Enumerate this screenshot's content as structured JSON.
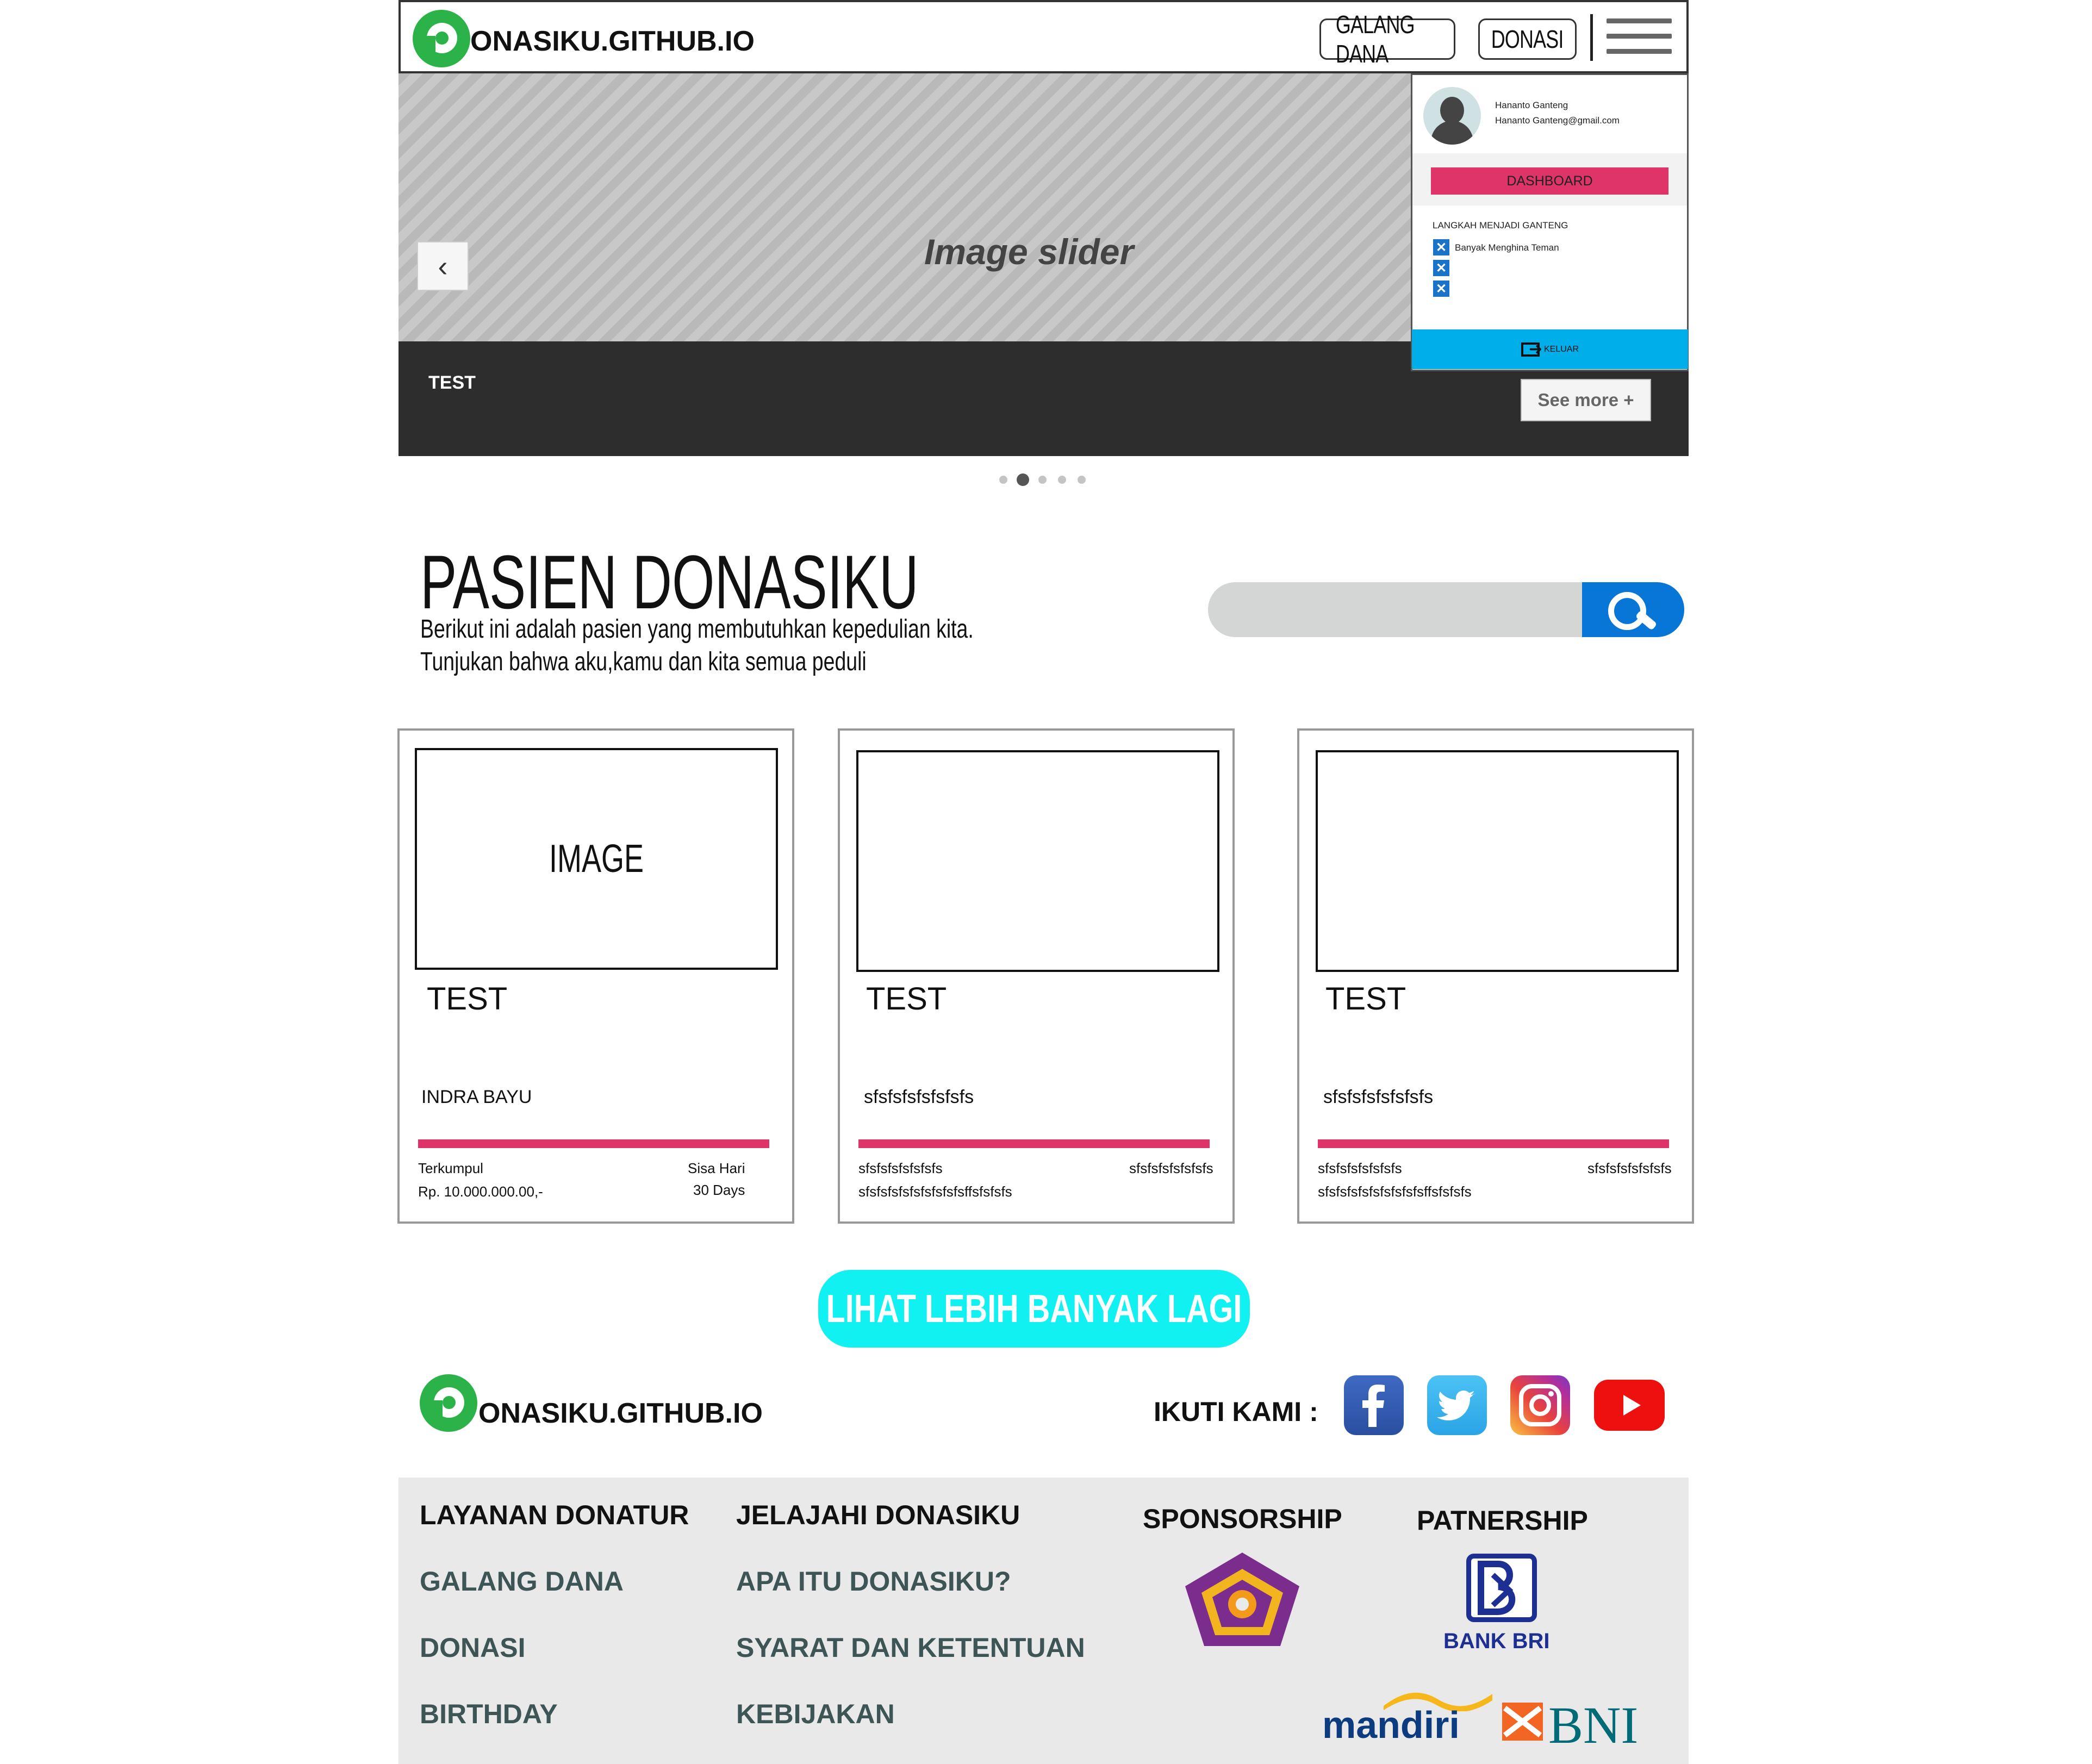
{
  "nav": {
    "brand_tail": "ONASIKU.GITHUB.IO",
    "galang_label": "GALANG DANA",
    "donasi_label": "DONASI"
  },
  "hero": {
    "title": "Image slider",
    "caption": "TEST",
    "see_more_label": "See more +",
    "prev_glyph": "‹",
    "active_slide": 2,
    "slide_count": 5
  },
  "user_panel": {
    "name": "Hananto Ganteng",
    "email": "Hananto Ganteng@gmail.com",
    "dashboard_label": "DASHBOARD",
    "steps_title": "LANGKAH MENJADI GANTENG",
    "steps": [
      "Banyak Menghina Teman",
      "",
      ""
    ],
    "logout_label": "KELUAR"
  },
  "patients": {
    "title": "PASIEN DONASIKU",
    "desc_line1": "Berikut ini adalah pasien yang membutuhkan kepedulian kita.",
    "desc_line2": "Tunjukan bahwa aku,kamu dan kita semua peduli",
    "search_placeholder": ""
  },
  "cards": [
    {
      "image_label": "IMAGE",
      "title": "TEST",
      "name": "INDRA BAYU",
      "left_top": "Terkumpul",
      "left_bottom": "Rp. 10.000.000.00,-",
      "right_top": "Sisa Hari",
      "right_bottom": "30 Days"
    },
    {
      "image_label": "",
      "title": "TEST",
      "name": "sfsfsfsfsfsfsfs",
      "left_top": "sfsfsfsfsfsfsfs",
      "left_bottom": "sfsfsfsfsfsfsfsfsfsffsfsfsfs",
      "right_top": "sfsfsfsfsfsfsfs",
      "right_bottom": ""
    },
    {
      "image_label": "",
      "title": "TEST",
      "name": "sfsfsfsfsfsfsfs",
      "left_top": "sfsfsfsfsfsfsfs",
      "left_bottom": "sfsfsfsfsfsfsfsfsfsffsfsfsfs",
      "right_top": "sfsfsfsfsfsfsfs",
      "right_bottom": ""
    }
  ],
  "load_more_label": "LIHAT LEBIH BANYAK LAGI",
  "footer": {
    "brand_tail": "ONASIKU.GITHUB.IO",
    "follow_label": "IKUTI KAMI :",
    "social_icons": [
      "facebook-icon",
      "twitter-icon",
      "instagram-icon",
      "youtube-icon"
    ],
    "col1_title": "LAYANAN DONATUR",
    "col1_links": [
      "GALANG DANA",
      "DONASI",
      "BIRTHDAY"
    ],
    "col2_title": "JELAJAHI DONASIKU",
    "col2_links": [
      "APA ITU DONASIKU?",
      "SYARAT DAN KETENTUAN",
      "KEBIJAKAN"
    ],
    "sponsorship_title": "SPONSORSHIP",
    "partnership_title": "PATNERSHIP",
    "partners": [
      "BANK BRI",
      "mandiri",
      "BNI"
    ]
  },
  "colors": {
    "brand_green": "#2bb34a",
    "accent_pink": "#de3469",
    "logout_blue": "#00aeea",
    "search_blue": "#0876d6",
    "load_more_cyan": "#12f1f1"
  }
}
